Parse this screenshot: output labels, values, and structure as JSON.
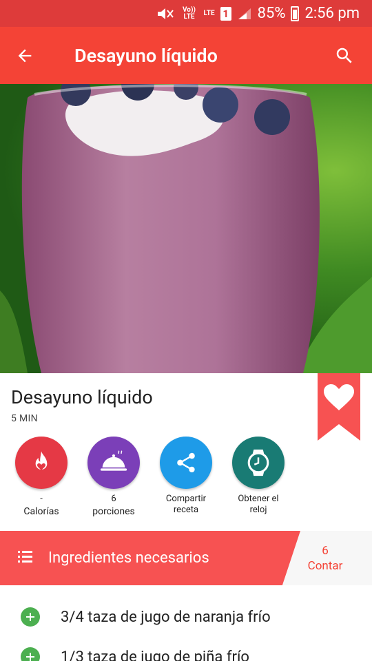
{
  "status_bar": {
    "volte": "Vo)) LTE",
    "lte": "LTE",
    "sim": "1",
    "battery": "85%",
    "time": "2:56 pm"
  },
  "app_bar": {
    "title": "Desayuno líquido"
  },
  "recipe": {
    "title": "Desayuno líquido",
    "time": "5 MIN"
  },
  "actions": [
    {
      "value": "-",
      "label": "Calorías",
      "color": "#e53945"
    },
    {
      "value": "6",
      "label": "porciones",
      "color": "#7b3fb8"
    },
    {
      "value": "Compartir",
      "label": "receta",
      "color": "#1e9be8"
    },
    {
      "value": "Obtener el",
      "label": "reloj",
      "color": "#197b74"
    }
  ],
  "ingredients_header": {
    "label": "Ingredientes necesarios",
    "count_value": "6",
    "count_label": "Contar"
  },
  "ingredients": [
    "3/4 taza de jugo de naranja frío",
    "1/3 taza de jugo de piña frío"
  ],
  "colors": {
    "status_bar": "#de3b3a",
    "app_bar": "#f44336",
    "accent": "#f75252",
    "add": "#4caf50"
  }
}
